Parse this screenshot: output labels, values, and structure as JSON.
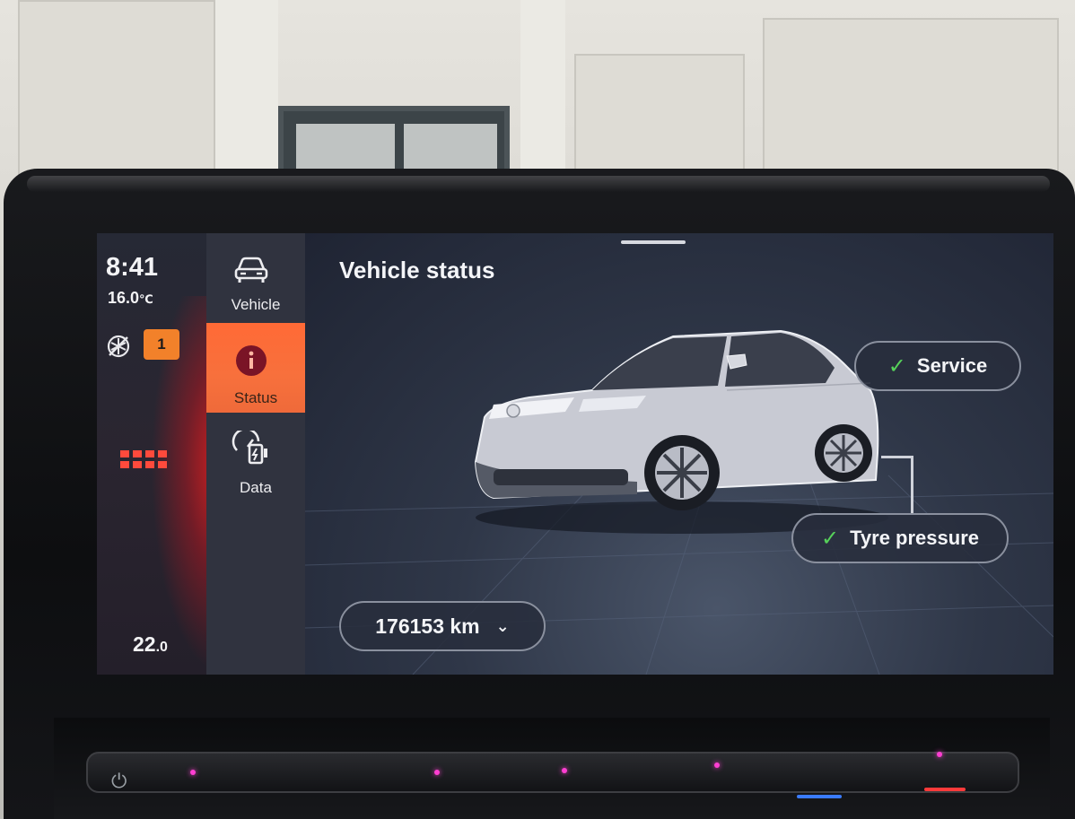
{
  "status_bar": {
    "time": "8:41",
    "outside_temp": "16.0",
    "outside_temp_unit": "℃",
    "notification_count": "1",
    "cabin_temp_whole": "22",
    "cabin_temp_decimal": ".0"
  },
  "nav": {
    "items": [
      {
        "label": "Vehicle",
        "icon": "car-icon",
        "active": false
      },
      {
        "label": "Status",
        "icon": "info-icon",
        "active": true
      },
      {
        "label": "Data",
        "icon": "trip-data-icon",
        "active": false
      }
    ]
  },
  "main": {
    "title": "Vehicle status",
    "service_label": "Service",
    "tyre_label": "Tyre pressure",
    "odometer": "176153 km"
  },
  "colors": {
    "accent_active": "#f7703c",
    "check_green": "#56d15a",
    "badge_orange": "#f2812a"
  }
}
